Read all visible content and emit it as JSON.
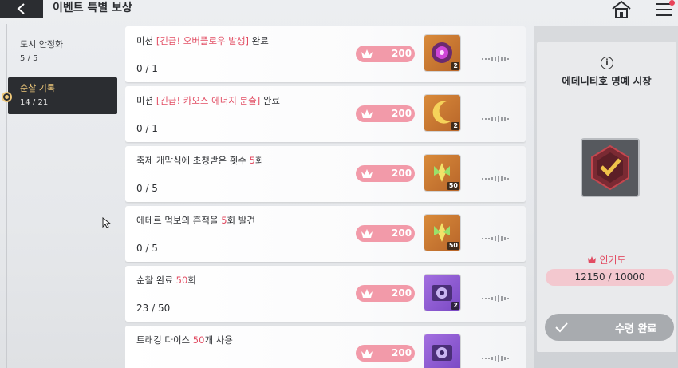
{
  "header": {
    "title": "이벤트 특별 보상",
    "back_icon": "back-arrow-icon",
    "home_icon": "home-icon",
    "menu_icon": "hamburger-menu-icon"
  },
  "sidebar": {
    "items": [
      {
        "label": "도시 안정화",
        "count": "5 / 5"
      },
      {
        "label": "순찰 기록",
        "count": "14 / 21"
      }
    ],
    "active_index": 1
  },
  "missions": [
    {
      "pre": "미션 ",
      "hl": "[긴급! 오버플로우 발생]",
      "post": " 완료",
      "progress": "0 / 1",
      "reward": "200",
      "item_qty": "2",
      "item_color": "orange",
      "item_icon": "purple-gem-icon"
    },
    {
      "pre": "미션 ",
      "hl": "[긴급! 카오스 에너지 분출]",
      "post": " 완료",
      "progress": "0 / 1",
      "reward": "200",
      "item_qty": "2",
      "item_color": "orange",
      "item_icon": "moon-icon"
    },
    {
      "pre": "축제 개막식에 초청받은 횟수 ",
      "hl": "5",
      "post": "회",
      "progress": "0 / 5",
      "reward": "200",
      "item_qty": "50",
      "item_color": "orange",
      "item_icon": "wing-crystal-icon"
    },
    {
      "pre": "에테르 먹보의 흔적을 ",
      "hl": "5",
      "post": "회 발견",
      "progress": "0 / 5",
      "reward": "200",
      "item_qty": "50",
      "item_color": "orange",
      "item_icon": "wing-crystal-icon"
    },
    {
      "pre": "순찰 완료 ",
      "hl": "50",
      "post": "회",
      "progress": "23 / 50",
      "reward": "200",
      "item_qty": "2",
      "item_color": "purple",
      "item_icon": "camera-icon"
    },
    {
      "pre": "트래킹 다이스 ",
      "hl": "50",
      "post": "개 사용",
      "progress": "",
      "reward": "200",
      "item_qty": "",
      "item_color": "purple",
      "item_icon": "camera-icon"
    }
  ],
  "panel": {
    "info_icon": "info-icon",
    "info_glyph": "i",
    "market_name": "에데니티호 명예 시장",
    "badge_icon": "checkmark-badge-icon",
    "popularity_label": "인기도",
    "popularity_value": "12150 / 10000",
    "popularity_fraction": 1.0,
    "claim_label": "수령 완료"
  },
  "colors": {
    "accent_pink": "#e24d63",
    "pill_pink": "#f29aa9",
    "dark": "#2b2d31",
    "gold": "#f0c97a"
  }
}
